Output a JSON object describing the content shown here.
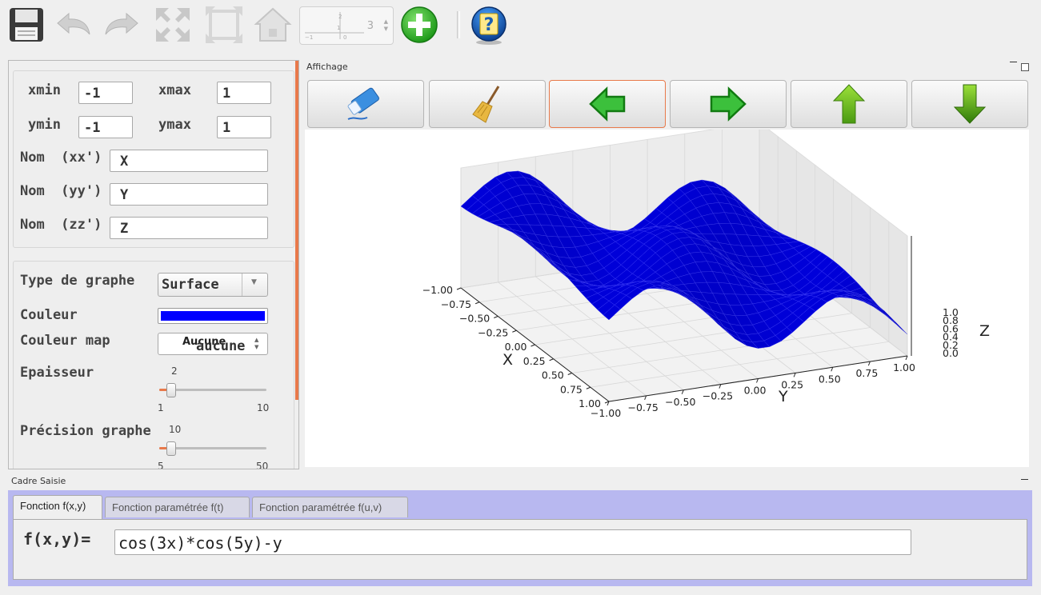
{
  "toolbar": {
    "items": [
      {
        "name": "save-icon",
        "enabled": true
      },
      {
        "name": "undo-icon",
        "enabled": false
      },
      {
        "name": "redo-icon",
        "enabled": false
      },
      {
        "name": "zoom-in-icon",
        "enabled": false
      },
      {
        "name": "zoom-out-icon",
        "enabled": false
      },
      {
        "name": "home-icon",
        "enabled": false
      },
      {
        "name": "add-icon",
        "enabled": true
      },
      {
        "name": "help-icon",
        "enabled": true
      }
    ],
    "spin_value": "3"
  },
  "params": {
    "xmin_label": "xmin",
    "xmin_value": "-1",
    "xmax_label": "xmax",
    "xmax_value": "1",
    "ymin_label": "ymin",
    "ymin_value": "-1",
    "ymax_label": "ymax",
    "ymax_value": "1",
    "nom_xx_label": "Nom  (xx')",
    "nom_xx_value": "X",
    "nom_yy_label": "Nom  (yy')",
    "nom_yy_value": "Y",
    "nom_zz_label": "Nom  (zz')",
    "nom_zz_value": "Z"
  },
  "graph": {
    "type_label": "Type de graphe",
    "type_value": "Surface",
    "couleur_label": "Couleur",
    "couleur_value": "#0000ff",
    "couleur_map_label": "Couleur map",
    "couleur_map_value_top": "Aucune",
    "couleur_map_value": "aucune",
    "epaisseur_label": "Epaisseur",
    "epaisseur_value": "2",
    "epaisseur_min": "1",
    "epaisseur_max": "10",
    "epaisseur_level": 0.11,
    "precision_label": "Précision graphe",
    "precision_value": "10",
    "precision_min": "5",
    "precision_max": "50",
    "precision_level": 0.11
  },
  "affichage": {
    "title": "Affichage",
    "buttons": [
      "eraser-icon",
      "broom-icon",
      "arrow-left-icon",
      "arrow-right-icon",
      "arrow-up-icon",
      "arrow-down-icon"
    ],
    "plot": {
      "x_axis_label": "X",
      "y_axis_label": "Y",
      "z_axis_label": "Z",
      "x_ticks": [
        "−1.00",
        "−0.75",
        "−0.50",
        "−0.25",
        "0.00",
        "0.25",
        "0.50",
        "0.75",
        "1.00"
      ],
      "y_ticks": [
        "−1.00",
        "−0.75",
        "−0.50",
        "−0.25",
        "0.00",
        "0.25",
        "0.50",
        "0.75",
        "1.00"
      ],
      "z_ticks": [
        "1.0",
        "0.8",
        "0.6",
        "0.4",
        "0.2",
        "0.0"
      ],
      "surface_color": "#0000ff"
    }
  },
  "saisie": {
    "title": "Cadre Saisie",
    "tabs": [
      "Fonction f(x,y)",
      "Fonction paramétrée f(t)",
      "Fonction paramétrée f(u,v)"
    ],
    "active_tab": 0,
    "function_label": "f(x,y)=",
    "function_value": "cos(3x)*cos(5y)-y"
  }
}
